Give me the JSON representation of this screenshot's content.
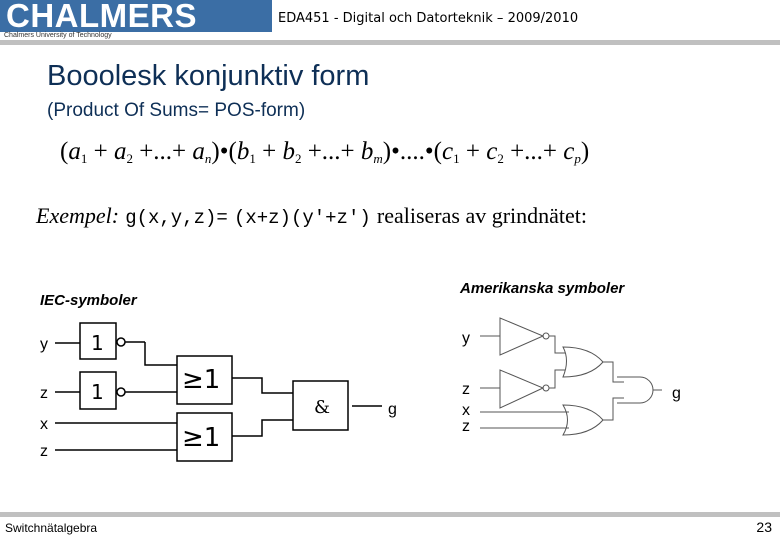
{
  "header": {
    "logo_text": "CHALMERS",
    "logo_subtitle": "Chalmers University of Technology",
    "course_title": "EDA451 - Digital och Datorteknik – 2009/2010",
    "brand_color": "#3b6ea5"
  },
  "slide": {
    "title": "Booolesk konjunktiv form",
    "subtitle": "(Product Of Sums= POS-form)",
    "formula": {
      "groups": [
        {
          "var": "a",
          "subs": [
            "1",
            "2",
            "n"
          ]
        },
        {
          "var": "b",
          "subs": [
            "1",
            "2",
            "m"
          ]
        },
        {
          "var": "c",
          "subs": [
            "1",
            "2",
            "p"
          ]
        }
      ],
      "plus": "+",
      "ellipsis": "...",
      "dot": "•",
      "dot_ellipsis": "....",
      "open": "(",
      "close": ")"
    },
    "example": {
      "label": "Exempel:",
      "expr_lhs": "g(x,y,z)=",
      "expr_rhs": "(x+z)(y'+z')",
      "rest": "realiseras av grindnätet:"
    }
  },
  "diagrams": {
    "iec": {
      "label": "IEC-symboler",
      "inputs": [
        "y",
        "z",
        "x",
        "z"
      ],
      "not_gate_symbol": "1",
      "or_gate_symbol": "≥1",
      "and_gate_symbol": "&",
      "output": "g"
    },
    "american": {
      "label": "Amerikanska symboler",
      "inputs": [
        "y",
        "z",
        "x",
        "z"
      ],
      "output": "g"
    }
  },
  "footer": {
    "topic": "Switchnätalgebra",
    "page_number": "23"
  }
}
